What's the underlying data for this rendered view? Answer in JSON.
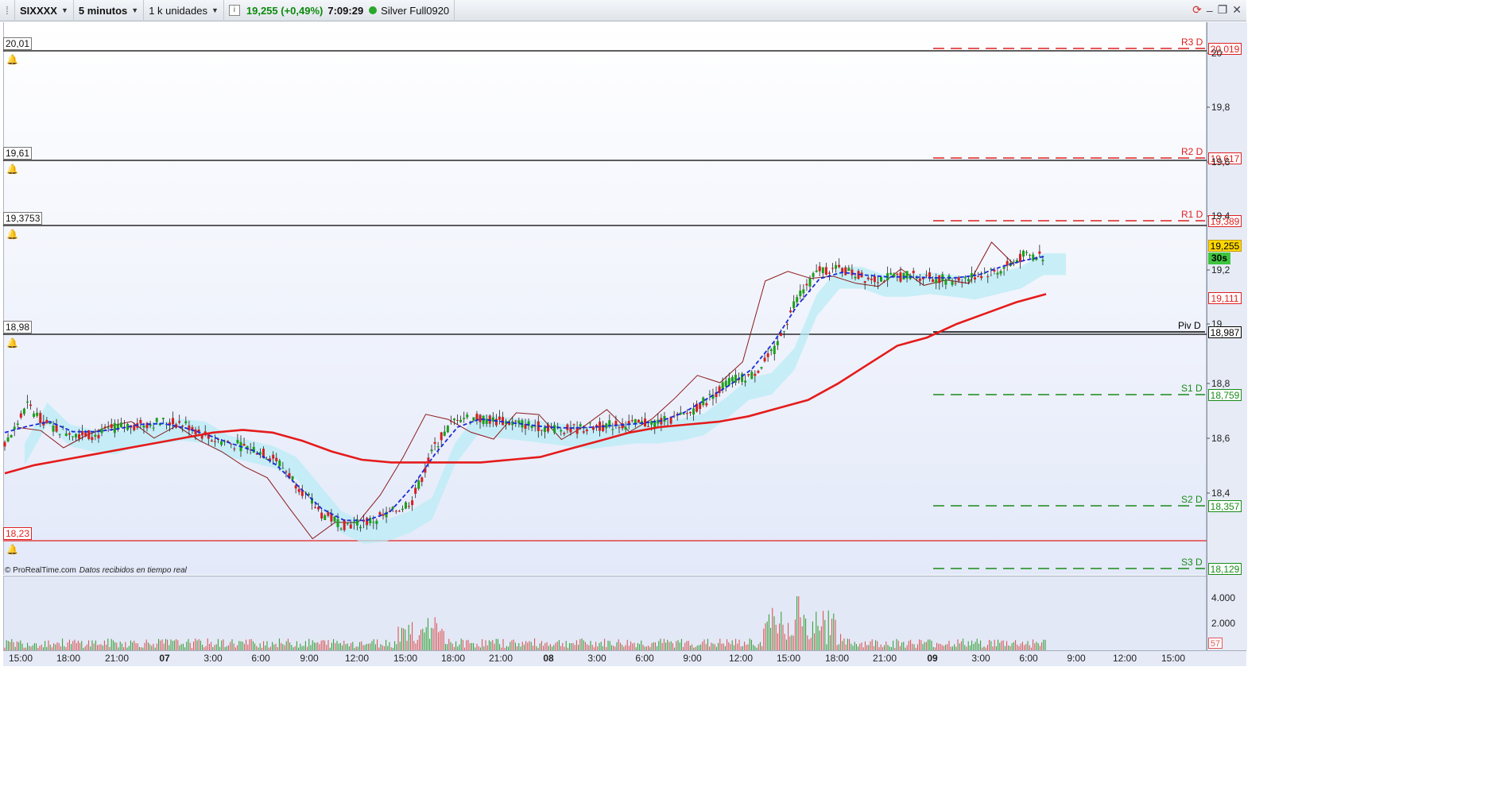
{
  "toolbar": {
    "symbol": "SIXXXX",
    "timeframe": "5 minutos",
    "units": "1 k unidades",
    "info_icon": "info-icon",
    "quote": "19,255 (+0,49%)",
    "time": "7:09:29",
    "status_name": "Silver Full0920"
  },
  "window_controls": {
    "refresh_icon": "refresh-icon",
    "minimize": "–",
    "restore": "❐",
    "close": "✕"
  },
  "hlines": [
    {
      "label": "20,01",
      "color": "#000000"
    },
    {
      "label": "19,61",
      "color": "#000000"
    },
    {
      "label": "19,3753",
      "color": "#000000"
    },
    {
      "label": "18,98",
      "color": "#000000"
    },
    {
      "label": "18,23",
      "color": "#e02020"
    }
  ],
  "pivots": [
    {
      "name": "R3 D",
      "price": "20,019",
      "color": "#e02020"
    },
    {
      "name": "R2 D",
      "price": "19,617",
      "color": "#e02020"
    },
    {
      "name": "R1 D",
      "price": "19,389",
      "color": "#e02020"
    },
    {
      "name": "Piv D",
      "price": "18,987",
      "color": "#000000"
    },
    {
      "name": "S1 D",
      "price": "18,759",
      "color": "#1a8a1a"
    },
    {
      "name": "S2 D",
      "price": "18,357",
      "color": "#1a8a1a"
    },
    {
      "name": "S3 D",
      "price": "18,129",
      "color": "#1a8a1a"
    }
  ],
  "price_tags": {
    "last": "19,255",
    "timer": "30s",
    "ma": "19,111"
  },
  "y_ticks": [
    "20",
    "19,8",
    "19,6",
    "19,4",
    "19,2",
    "19",
    "18,8",
    "18,6",
    "18,4"
  ],
  "vol_ticks": [
    "4.000",
    "2.000"
  ],
  "vol_last": "57",
  "x_ticks": [
    {
      "t": "15:00",
      "day": false
    },
    {
      "t": "18:00",
      "day": false
    },
    {
      "t": "21:00",
      "day": false
    },
    {
      "t": "07",
      "day": true
    },
    {
      "t": "3:00",
      "day": false
    },
    {
      "t": "6:00",
      "day": false
    },
    {
      "t": "9:00",
      "day": false
    },
    {
      "t": "12:00",
      "day": false
    },
    {
      "t": "15:00",
      "day": false
    },
    {
      "t": "18:00",
      "day": false
    },
    {
      "t": "21:00",
      "day": false
    },
    {
      "t": "08",
      "day": true
    },
    {
      "t": "3:00",
      "day": false
    },
    {
      "t": "6:00",
      "day": false
    },
    {
      "t": "9:00",
      "day": false
    },
    {
      "t": "12:00",
      "day": false
    },
    {
      "t": "15:00",
      "day": false
    },
    {
      "t": "18:00",
      "day": false
    },
    {
      "t": "21:00",
      "day": false
    },
    {
      "t": "09",
      "day": true
    },
    {
      "t": "3:00",
      "day": false
    },
    {
      "t": "6:00",
      "day": false
    },
    {
      "t": "9:00",
      "day": false
    },
    {
      "t": "12:00",
      "day": false
    },
    {
      "t": "15:00",
      "day": false
    }
  ],
  "credit": {
    "brand": "© ProRealTime.com",
    "note": "Datos recibidos en tiempo real"
  },
  "chart_data": {
    "type": "line",
    "series": [
      {
        "values": [
          18.55,
          18.7,
          18.62,
          18.6,
          18.59,
          18.62,
          18.63,
          18.64,
          18.63,
          18.58,
          18.56,
          18.54,
          18.5,
          18.4,
          18.3,
          18.26,
          18.27,
          18.3,
          18.35,
          18.55,
          18.66,
          18.65,
          18.64,
          18.63,
          18.62,
          18.61,
          18.62,
          18.63,
          18.63,
          18.64,
          18.66,
          18.72,
          18.79,
          18.81,
          18.9,
          19.1,
          19.2,
          19.2,
          19.17,
          19.17,
          19.18,
          19.17,
          19.16,
          19.18,
          19.2,
          19.25,
          19.25
        ]
      },
      {
        "values": [
          18.45,
          18.48,
          18.5,
          18.52,
          18.54,
          18.56,
          18.58,
          18.6,
          18.61,
          18.6,
          18.57,
          18.53,
          18.5,
          18.49,
          18.49,
          18.49,
          18.49,
          18.5,
          18.51,
          18.54,
          18.57,
          18.6,
          18.62,
          18.63,
          18.64,
          18.66,
          18.69,
          18.72,
          18.78,
          18.85,
          18.92,
          18.95,
          19.0,
          19.04,
          19.08,
          19.11
        ]
      }
    ],
    "x_categories": [
      "15:00",
      "18:00",
      "21:00",
      "07",
      "3:00",
      "6:00",
      "9:00",
      "12:00",
      "15:00",
      "18:00",
      "21:00",
      "08",
      "3:00",
      "6:00",
      "9:00",
      "12:00",
      "15:00",
      "18:00",
      "21:00",
      "09",
      "3:00",
      "6:00"
    ],
    "ylim": [
      18.1,
      20.05
    ]
  }
}
